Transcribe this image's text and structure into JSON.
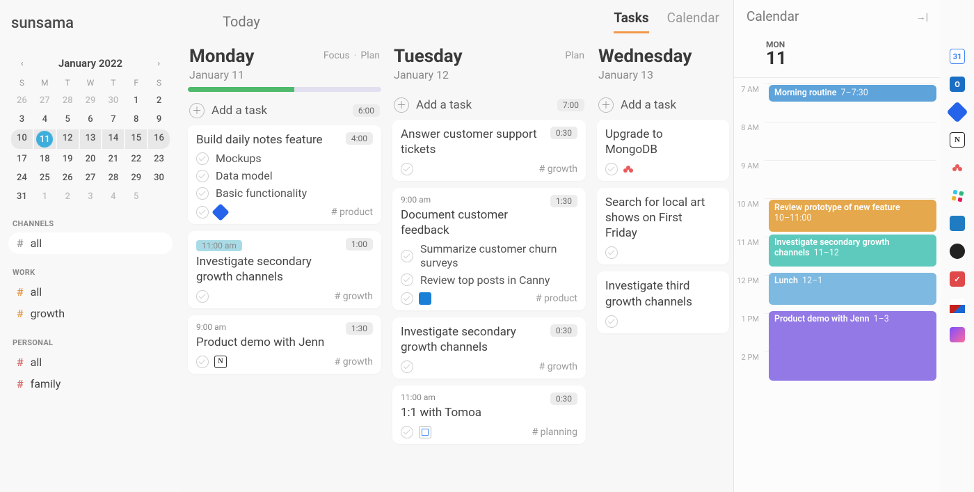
{
  "logo": "sunsama",
  "top": {
    "today": "Today",
    "tabs": {
      "tasks": "Tasks",
      "calendar": "Calendar"
    }
  },
  "mini_cal": {
    "title": "January 2022",
    "dow": [
      "S",
      "M",
      "T",
      "W",
      "T",
      "F",
      "S"
    ]
  },
  "channels": {
    "label": "CHANNELS",
    "all": "all",
    "work_label": "WORK",
    "work_all": "all",
    "work_growth": "growth",
    "personal_label": "PERSONAL",
    "personal_all": "all",
    "personal_family": "family"
  },
  "cols": {
    "mon": {
      "name": "Monday",
      "date": "January 11",
      "focus": "Focus",
      "plan": "Plan",
      "add": "Add a task",
      "addtime": "6:00",
      "c1": {
        "title": "Build daily notes feature",
        "dur": "4:00",
        "s1": "Mockups",
        "s2": "Data model",
        "s3": "Basic functionality",
        "tag": "# product"
      },
      "c2": {
        "sched": "11:00 am",
        "title": "Investigate secondary growth channels",
        "dur": "1:00",
        "tag": "# growth"
      },
      "c3": {
        "sched": "9:00 am",
        "title": "Product demo with Jenn",
        "dur": "1:30",
        "tag": "# growth"
      }
    },
    "tue": {
      "name": "Tuesday",
      "date": "January 12",
      "plan": "Plan",
      "add": "Add a task",
      "addtime": "7:00",
      "c1": {
        "title": "Answer customer support tickets",
        "dur": "0:30",
        "tag": "# growth"
      },
      "c2": {
        "sched": "9:00 am",
        "title": "Document customer feedback",
        "dur": "1:30",
        "s1": "Summarize customer churn surveys",
        "s2": "Review top posts in Canny",
        "tag": "# product"
      },
      "c3": {
        "title": "Investigate secondary growth channels",
        "dur": "0:30",
        "tag": "# growth"
      },
      "c4": {
        "sched": "11:00 am",
        "title": "1:1 with Tomoa",
        "dur": "0:30",
        "tag": "# planning"
      }
    },
    "wed": {
      "name": "Wednesday",
      "date": "January 13",
      "add": "Add a task",
      "c1": {
        "title": "Upgrade to MongoDB"
      },
      "c2": {
        "title": "Search for local art shows on First Friday"
      },
      "c3": {
        "title": "Investigate third growth channels"
      }
    }
  },
  "calpanel": {
    "title": "Calendar",
    "dow": "MON",
    "day": "11",
    "hours": [
      "7 AM",
      "8 AM",
      "9 AM",
      "10 AM",
      "11 AM",
      "12 PM",
      "1 PM",
      "2 PM"
    ],
    "ev1": {
      "t": "Morning routine",
      "tm": "7–7:30"
    },
    "ev2": {
      "t": "Review prototype of new feature",
      "tm": "10–11:00"
    },
    "ev3": {
      "t": "Investigate secondary growth channels",
      "tm": "11–12"
    },
    "ev4": {
      "t": "Lunch",
      "tm": "12–1"
    },
    "ev5": {
      "t": "Product demo with Jenn",
      "tm": "1–3"
    }
  }
}
